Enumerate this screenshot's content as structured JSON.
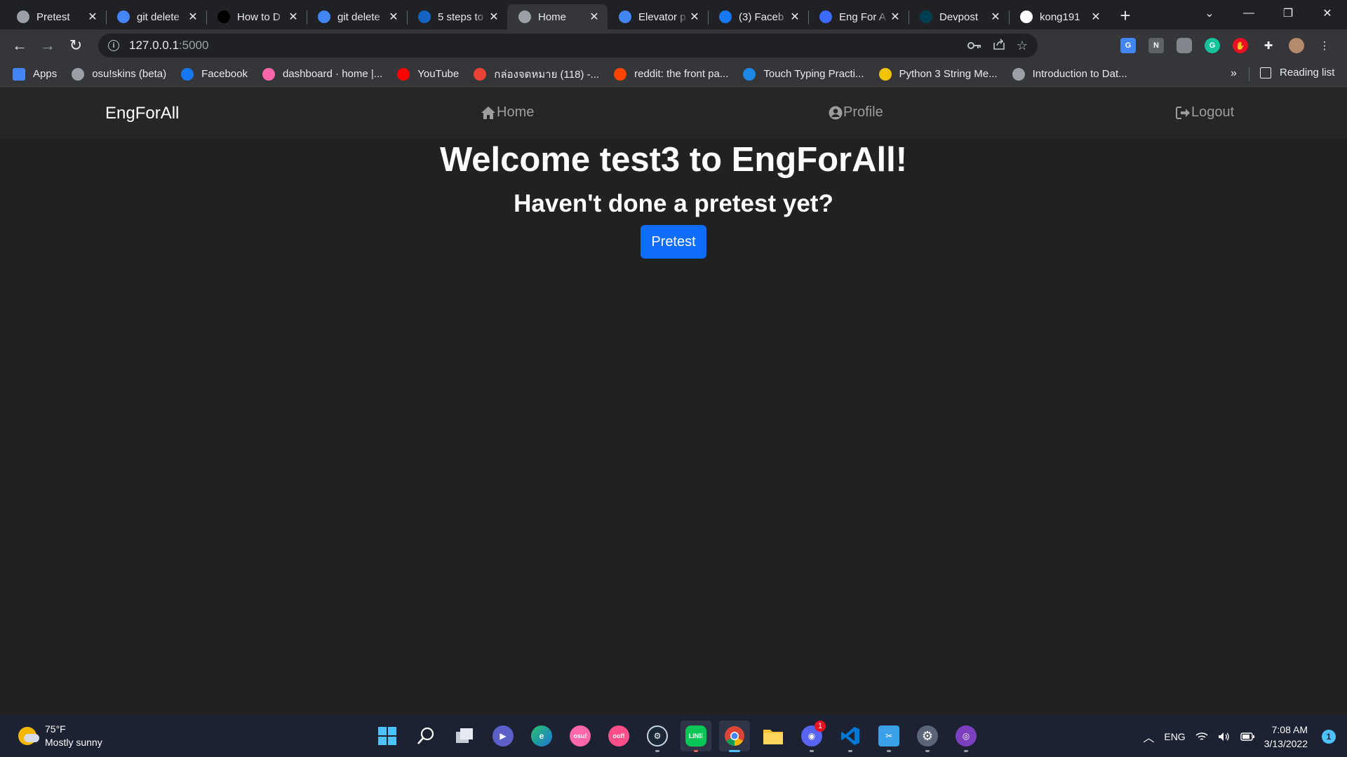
{
  "browser": {
    "tabs": [
      {
        "title": "Pretest",
        "favicon": "globe-icon",
        "color": "#9aa0a6"
      },
      {
        "title": "git delete",
        "favicon": "google-icon",
        "color": "#4285f4"
      },
      {
        "title": "How to D",
        "favicon": "devto-icon",
        "color": "#000000"
      },
      {
        "title": "git delete",
        "favicon": "google-icon",
        "color": "#4285f4"
      },
      {
        "title": "5 steps to",
        "favicon": "sm-icon",
        "color": "#1565c0"
      },
      {
        "title": "Home",
        "favicon": "globe-icon",
        "color": "#9aa0a6"
      },
      {
        "title": "Elevator p",
        "favicon": "google-icon",
        "color": "#4285f4"
      },
      {
        "title": "(3) Faceb",
        "favicon": "facebook-icon",
        "color": "#1877f2"
      },
      {
        "title": "Eng For A",
        "favicon": "c-icon",
        "color": "#3b6cff"
      },
      {
        "title": "Devpost",
        "favicon": "devpost-icon",
        "color": "#003e54"
      },
      {
        "title": "kong191",
        "favicon": "github-icon",
        "color": "#ffffff"
      }
    ],
    "active_tab_index": 5,
    "newtab_label": "+",
    "url_host": "127.0.0.1",
    "url_port": ":5000"
  },
  "bookmarks": [
    {
      "label": "Apps",
      "icon": "apps-grid-icon",
      "color": "#4285f4"
    },
    {
      "label": "osu!skins (beta)",
      "icon": "globe-icon",
      "color": "#9aa0a6"
    },
    {
      "label": "Facebook",
      "icon": "facebook-icon",
      "color": "#1877f2"
    },
    {
      "label": "dashboard · home |...",
      "icon": "osu-icon",
      "color": "#ff66aa"
    },
    {
      "label": "YouTube",
      "icon": "youtube-icon",
      "color": "#ff0000"
    },
    {
      "label": "กล่องจดหมาย (118) -...",
      "icon": "gmail-icon",
      "color": "#ea4335"
    },
    {
      "label": "reddit: the front pa...",
      "icon": "reddit-icon",
      "color": "#ff4500"
    },
    {
      "label": "Touch Typing Practi...",
      "icon": "typingstudy-icon",
      "color": "#1e88e5"
    },
    {
      "label": "Python 3 String Me...",
      "icon": "q-icon",
      "color": "#f2c300"
    },
    {
      "label": "Introduction to Dat...",
      "icon": "globe-icon",
      "color": "#9aa0a6"
    }
  ],
  "bookmarks_more": "»",
  "reading_list": "Reading list",
  "site": {
    "brand": "EngForAll",
    "nav": {
      "home": "Home",
      "profile": "Profile",
      "logout": "Logout"
    },
    "welcome": "Welcome test3 to EngForAll!",
    "subtitle": "Haven't done a pretest yet?",
    "pretest_button": "Pretest",
    "accent": "#0d6efd"
  },
  "taskbar": {
    "weather_temp": "75°F",
    "weather_desc": "Mostly sunny",
    "language": "ENG",
    "time": "7:08 AM",
    "date": "3/13/2022",
    "notifications": "1",
    "discord_badge": "1"
  }
}
